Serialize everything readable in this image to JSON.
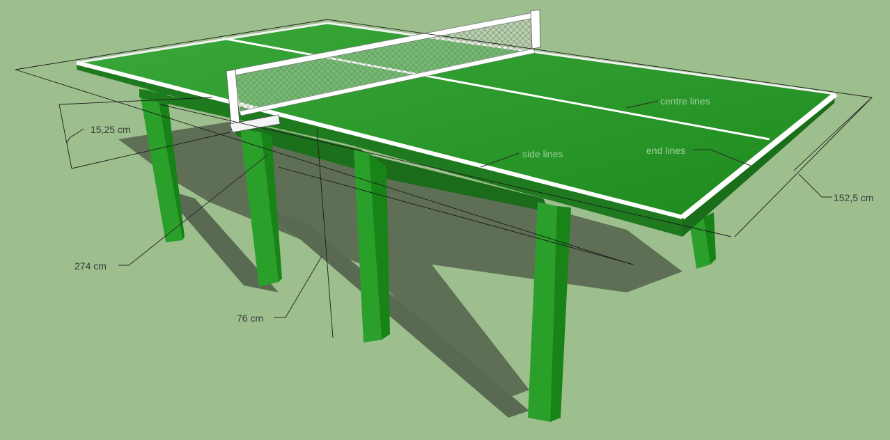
{
  "labels": {
    "width": "15,25 cm",
    "length": "274 cm",
    "height": "76 cm",
    "side_lines": "side lines",
    "centre_lines": "centre lines",
    "end_lines": "end lines",
    "table_width": "152,5 cm"
  },
  "colors": {
    "background": "#9dbf8e",
    "table_top": "#2f9a2f",
    "table_edge": "#1f7a1f",
    "legs": "#2aa02a",
    "shadow": "#5e6e55",
    "lines": "#ffffff"
  }
}
